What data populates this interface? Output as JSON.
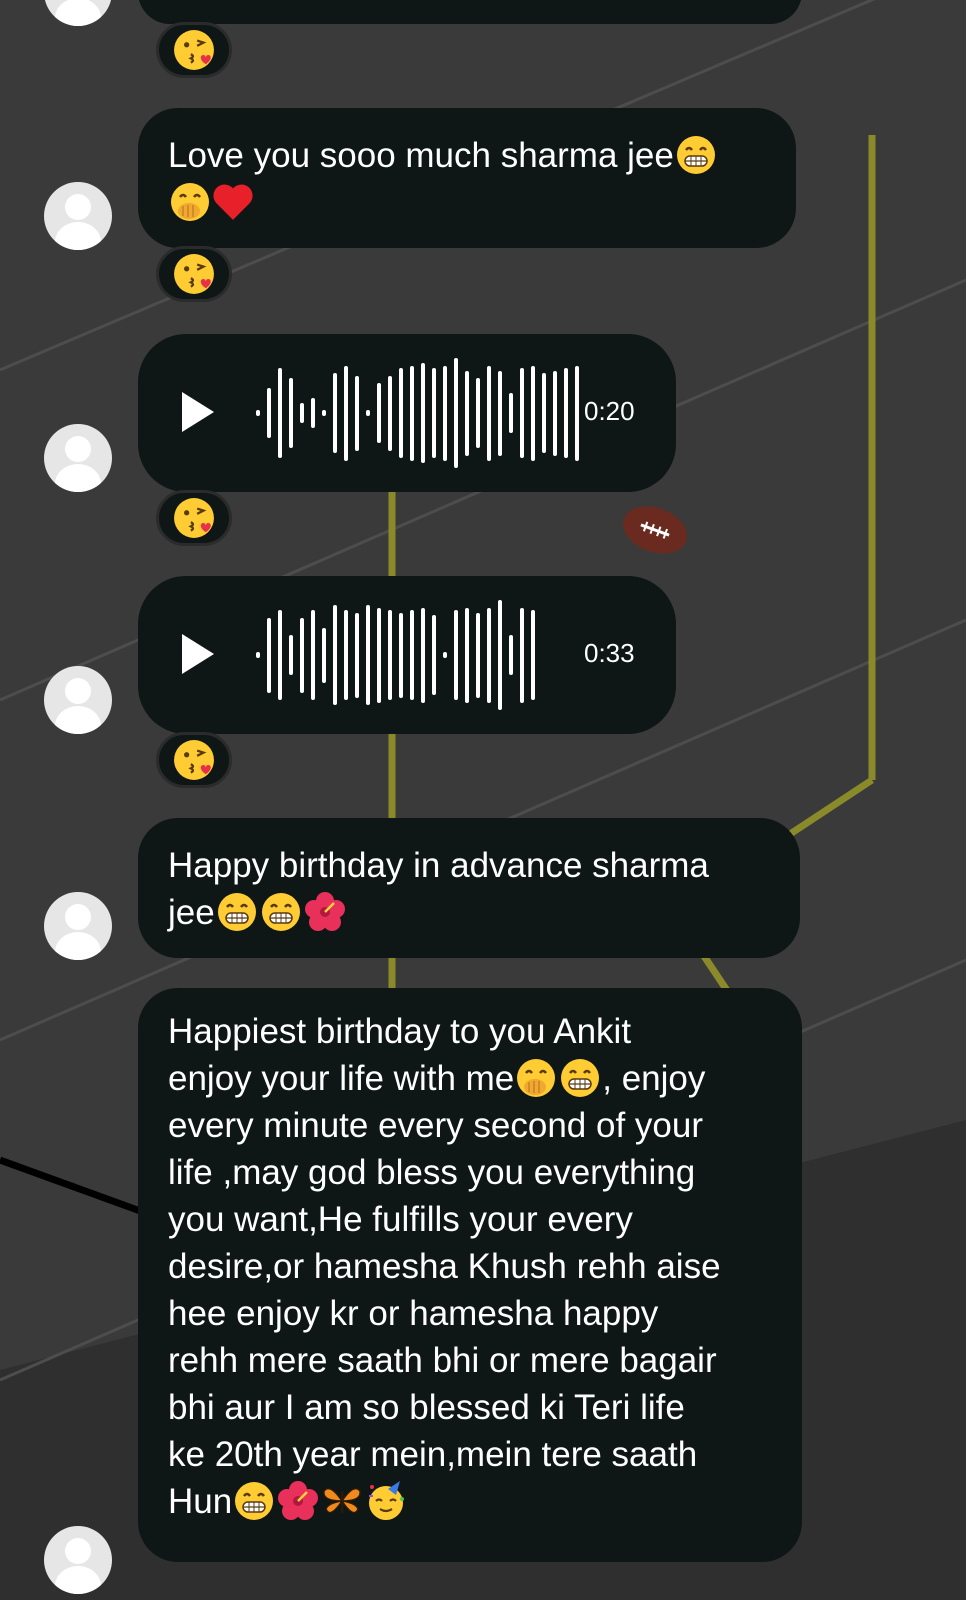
{
  "messages": [
    {
      "type": "text",
      "text_parts": [
        "Love you sooo much sharma jee",
        "😁",
        "🤭",
        "❤️"
      ]
    },
    {
      "type": "voice",
      "duration": "0:20"
    },
    {
      "type": "voice",
      "duration": "0:33"
    },
    {
      "type": "text",
      "text_parts": [
        "Happy birthday in advance sharma jee",
        "😁",
        "😁",
        "🌺"
      ]
    },
    {
      "type": "text",
      "lines": [
        "Happiest birthday to you Ankit",
        "enjoy your life with me",
        ", enjoy",
        "every minute every second of your",
        "life ,may god bless you everything",
        "you want,He fulfills your every",
        "desire,or hamesha Khush rehh aise",
        "hee enjoy kr or hamesha happy",
        "rehh mere saath bhi or mere bagair",
        "bhi aur I am so blessed ki Teri life",
        "ke 20th year mein,mein tere saath",
        "Hun"
      ],
      "emoji_parts": [
        "🤭",
        "😁",
        "😁",
        "🌺",
        "🦋",
        "🥳"
      ]
    }
  ],
  "reaction_emoji": "😘",
  "colors": {
    "bubble": "#0e1716",
    "background": "#3a3a3a",
    "goalpost": "#8a8a2a",
    "text": "#ffffff"
  }
}
